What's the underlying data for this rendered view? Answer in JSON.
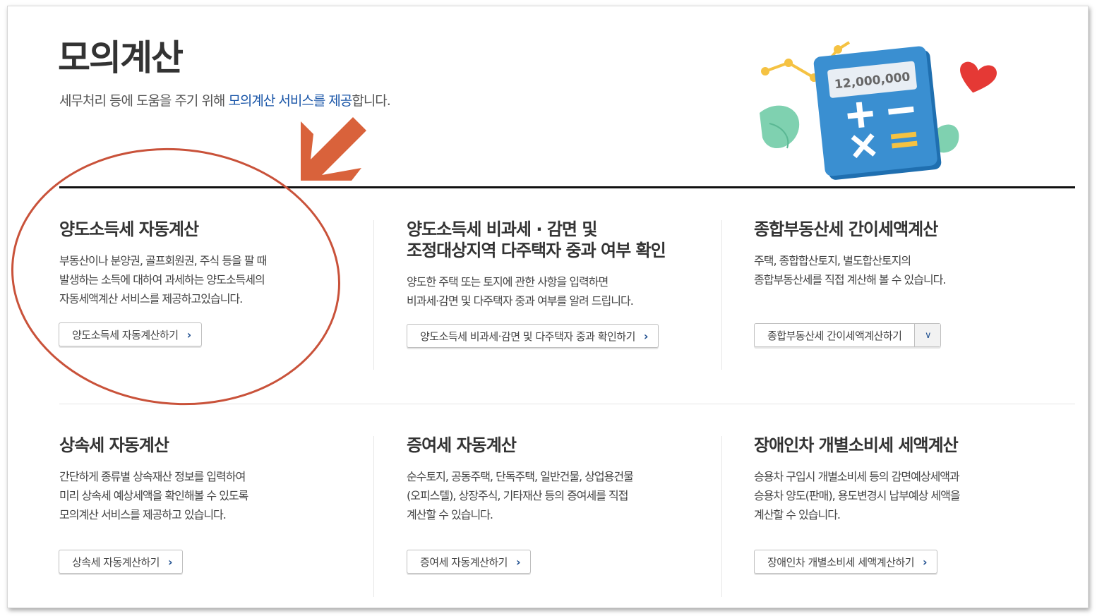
{
  "header": {
    "title": "모의계산",
    "intro_pre": "세무처리 등에 도움을 주기 위해 ",
    "intro_highlight": "모의계산 서비스를 제공",
    "intro_post": "합니다."
  },
  "illustration": {
    "calculator_display": "12,000,000",
    "icons": [
      "calculator-icon",
      "heart-icon",
      "leaf-icon",
      "line-chart-icon"
    ],
    "colors": {
      "calculator": "#2f7fc1",
      "heart": "#e53935",
      "leaf": "#6cc4a4",
      "chart": "#f5c242"
    }
  },
  "annotation": {
    "arrow_color": "#d9623b",
    "circle_color": "#c9523a"
  },
  "cards": [
    {
      "title": "양도소득세 자동계산",
      "desc": [
        "부동산이나 분양권, 골프회원권, 주식 등을 팔 때",
        "발생하는 소득에 대하여 과세하는 양도소득세의",
        "자동세액계산 서비스를 제공하고있습니다."
      ],
      "button": "양도소득세 자동계산하기"
    },
    {
      "title_lines": [
        "양도소득세 비과세 · 감면 및",
        "조정대상지역 다주택자 중과 여부 확인"
      ],
      "desc": [
        "양도한 주택 또는 토지에 관한 사항을 입력하면",
        "비과세·감면 및 다주택자 중과 여부를 알려 드립니다."
      ],
      "button": "양도소득세 비과세·감면 및 다주택자 중과 확인하기"
    },
    {
      "title": "종합부동산세 간이세액계산",
      "desc": [
        "주택, 종합합산토지, 별도합산토지의",
        "종합부동산세를 직접 계산해 볼 수 있습니다."
      ],
      "button": "종합부동산세 간이세액계산하기"
    },
    {
      "title": "상속세 자동계산",
      "desc": [
        "간단하게 종류별 상속재산 정보를 입력하여",
        "미리 상속세 예상세액을 확인해볼 수 있도록",
        "모의계산 서비스를 제공하고 있습니다."
      ],
      "button": "상속세 자동계산하기"
    },
    {
      "title": "증여세 자동계산",
      "desc": [
        "순수토지, 공동주택, 단독주택, 일반건물, 상업용건물",
        "(오피스텔), 상장주식, 기타재산 등의 증여세를 직접",
        "계산할 수 있습니다."
      ],
      "button": "증여세 자동계산하기"
    },
    {
      "title": "장애인차 개별소비세 세액계산",
      "desc": [
        "승용차 구입시 개별소비세 등의 감면예상세액과",
        "승용차 양도(판매), 용도변경시 납부예상 세액을",
        "계산할 수 있습니다."
      ],
      "button": "장애인차 개별소비세 세액계산하기"
    }
  ]
}
